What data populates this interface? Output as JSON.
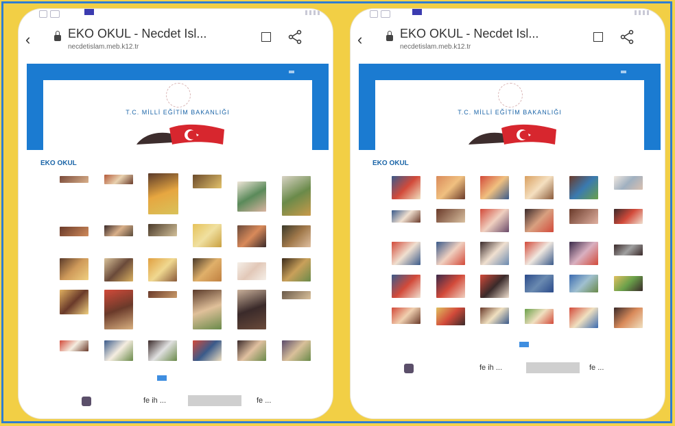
{
  "screens": [
    {
      "browser": {
        "title": "EKO OKUL - Necdet Isl...",
        "url": "necdetislam.meb.k12.tr"
      },
      "site": {
        "ministry": "T.C. MİLLİ EĞİTİM BAKANLIĞI",
        "section_title": "EKO OKUL"
      },
      "footer": {
        "text": "fe ih ...",
        "tail": "fe ..."
      }
    },
    {
      "browser": {
        "title": "EKO OKUL - Necdet Isl...",
        "url": "necdetislam.meb.k12.tr"
      },
      "site": {
        "ministry": "T.C. MİLLİ EĞİTİM BAKANLIĞI",
        "section_title": "EKO OKUL"
      },
      "footer": {
        "text": "fe ih ...",
        "tail": "fe ..."
      }
    }
  ],
  "colors": {
    "frame_border": "#2f7dd1",
    "background": "#f2cf45",
    "banner_blue": "#1b7bd1",
    "link_blue": "#1b65a8"
  },
  "icons": {
    "back": "chevron-left-icon",
    "lock": "lock-icon",
    "bookmark": "bookmark-icon",
    "share": "share-icon"
  }
}
